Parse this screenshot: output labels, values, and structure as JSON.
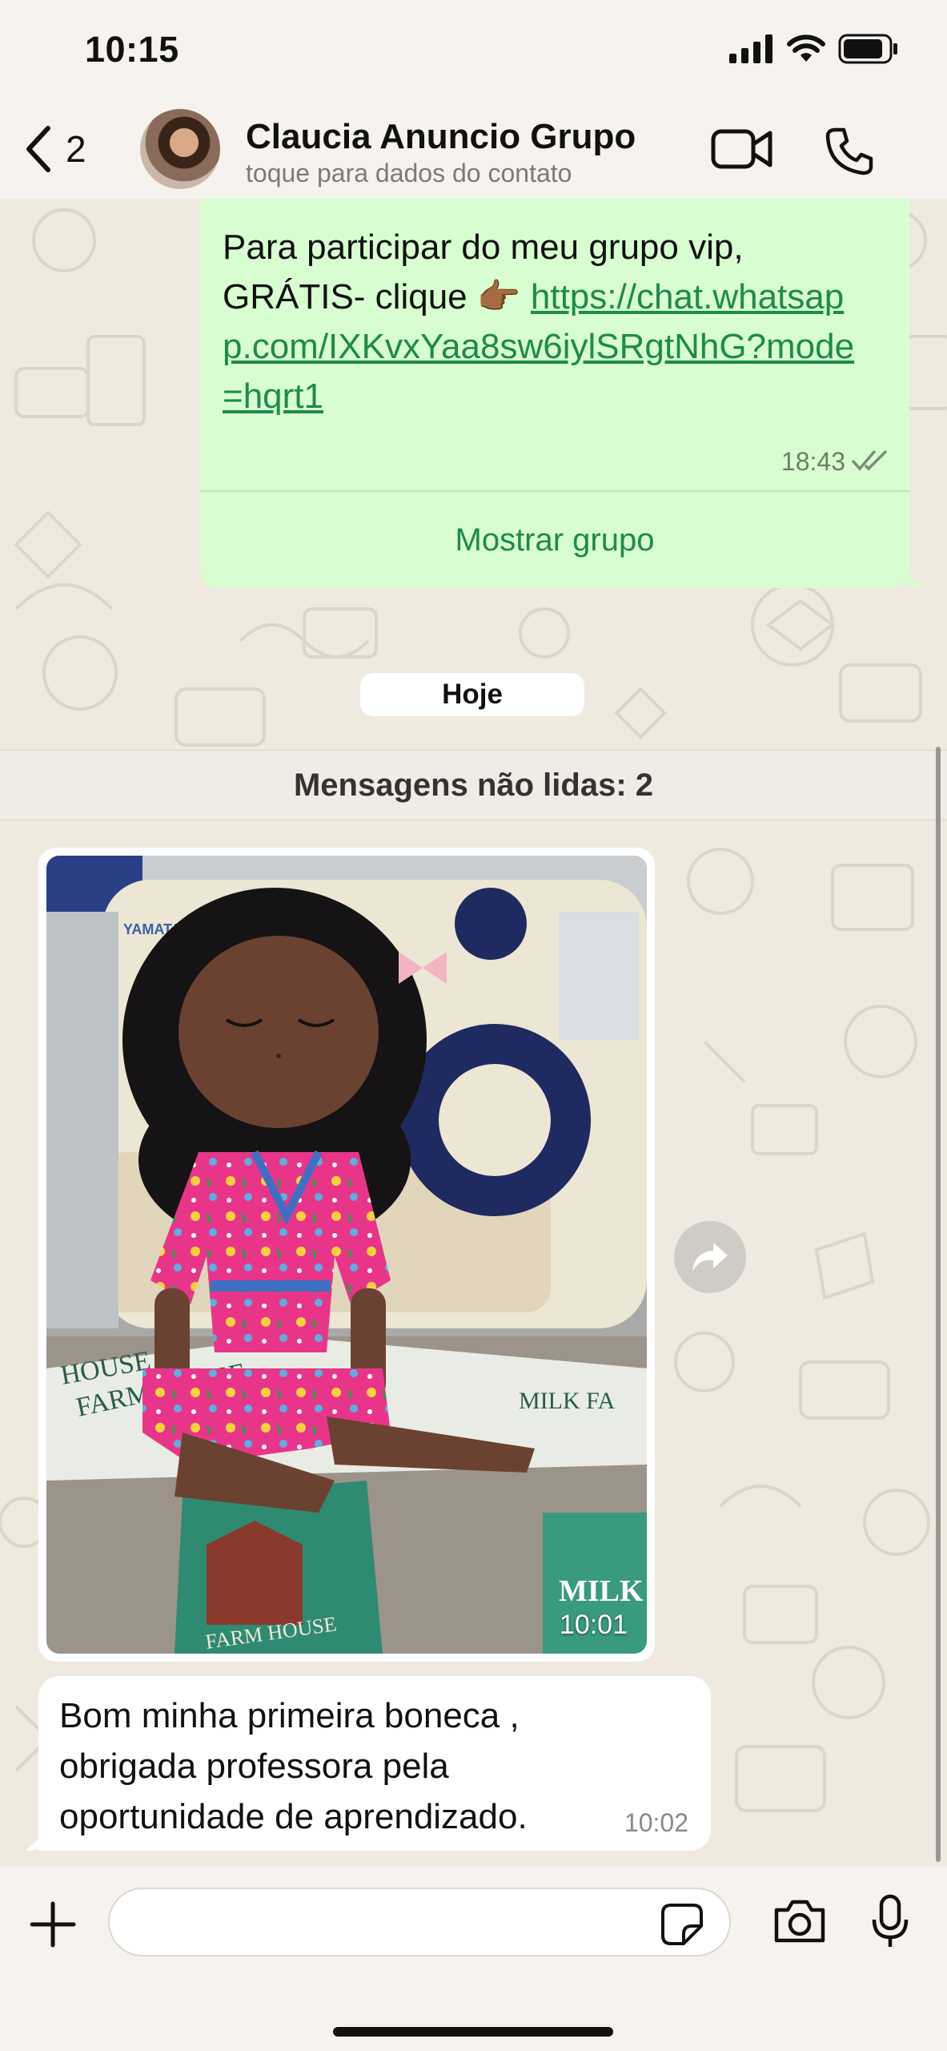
{
  "status_bar": {
    "time": "10:15"
  },
  "header": {
    "back_count": "2",
    "contact_name": "Claucia Anuncio Grupo",
    "contact_subtitle": "toque para dados do contato"
  },
  "messages": {
    "sent": {
      "text_prefix": "Para participar do meu grupo vip, GRÁTIS- clique 👉🏾 ",
      "link": "https://chat.whatsapp.com/IXKvxYaa8sw6iylSRgtNhG?mode=hqrt1",
      "time": "18:43",
      "action_label": "Mostrar grupo"
    },
    "date_chip": "Hoje",
    "unread_banner": "Mensagens não lidas: 2",
    "image": {
      "time": "10:01",
      "printed_labels": [
        "YAMATA",
        "FARM HOUSE",
        "MILK FA",
        "HOUSE",
        "FARM HOUSE",
        "MILK"
      ]
    },
    "received_text": {
      "text": "Bom minha primeira boneca , obrigada professora pela oportunidade de aprendizado.",
      "time": "10:02"
    }
  },
  "input_bar": {
    "placeholder": ""
  },
  "colors": {
    "sent_bubble": "#d8fdd1",
    "link_green": "#1e8a4f",
    "received_bubble": "#ffffff",
    "background": "#efe9df"
  },
  "icons": [
    "chevron-left-icon",
    "video-call-icon",
    "phone-icon",
    "double-check-icon",
    "forward-icon",
    "plus-icon",
    "sticker-icon",
    "camera-icon",
    "microphone-icon",
    "signal-icon",
    "wifi-icon",
    "battery-icon"
  ]
}
